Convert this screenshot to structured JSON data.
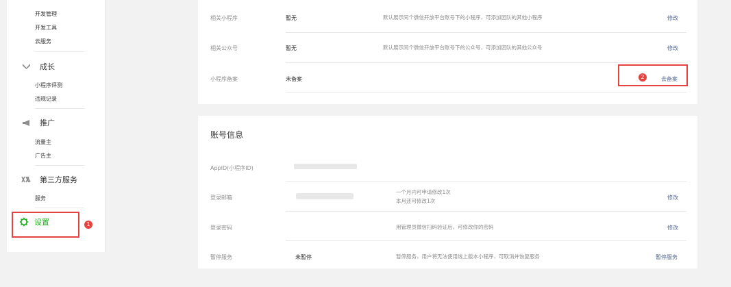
{
  "sidebar": {
    "dev_items": [
      "开发管理",
      "开发工具",
      "云服务"
    ],
    "growth": {
      "label": "成长",
      "items": [
        "小程序评测",
        "违规记录"
      ]
    },
    "promo": {
      "label": "推广",
      "items": [
        "流量主",
        "广告主"
      ]
    },
    "third": {
      "label": "第三方服务",
      "items": [
        "服务"
      ]
    },
    "settings": {
      "label": "设置",
      "badge": "1"
    }
  },
  "card1": {
    "rows": [
      {
        "label": "相关小程序",
        "value": "暂无",
        "desc": "默认展示同个微信开放平台账号下的小程序，可添加团队的其他小程序",
        "action": "修改"
      },
      {
        "label": "相关公众号",
        "value": "暂无",
        "desc": "默认展示同个微信开放平台账号下的公众号，可添加团队的其他公众号",
        "action": "修改"
      },
      {
        "label": "小程序备案",
        "value": "未备案",
        "desc": "",
        "action": "去备案",
        "badge": "2"
      }
    ]
  },
  "card2": {
    "title": "账号信息",
    "appid_label": "AppID(小程序ID)",
    "email_label": "登录邮箱",
    "email_desc_1": "一个月内可申请修改1次",
    "email_desc_2": "本月还可修改1次",
    "email_action": "修改",
    "password_label": "登录密码",
    "password_desc": "用管理员微信扫码验证后，可修改你的密码",
    "password_action": "修改",
    "suspend_label": "暂停服务",
    "suspend_value": "未暂停",
    "suspend_desc": "暂停服务，用户将无法使用线上版本小程序，可取消并恢复服务",
    "suspend_action": "暂停服务"
  },
  "colors": {
    "accent_green": "#1aad19",
    "link_blue": "#576b95",
    "highlight_red": "#e64340"
  }
}
